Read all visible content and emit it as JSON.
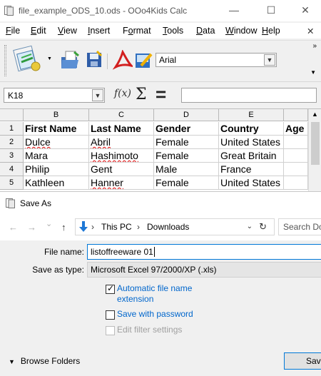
{
  "calc": {
    "window_title": "file_example_ODS_10.ods - OOo4Kids Calc",
    "controls": {
      "minimize": "—",
      "maximize": "☐",
      "close": "✕"
    },
    "menu": [
      {
        "pre": "",
        "u": "F",
        "post": "ile"
      },
      {
        "pre": "",
        "u": "E",
        "post": "dit"
      },
      {
        "pre": "",
        "u": "V",
        "post": "iew"
      },
      {
        "pre": "",
        "u": "I",
        "post": "nsert"
      },
      {
        "pre": "F",
        "u": "o",
        "post": "rmat"
      },
      {
        "pre": "",
        "u": "T",
        "post": "ools"
      },
      {
        "pre": "",
        "u": "D",
        "post": "ata"
      },
      {
        "pre": "",
        "u": "W",
        "post": "indow"
      },
      {
        "pre": "",
        "u": "H",
        "post": "elp"
      }
    ],
    "menu_close": "✕",
    "toolbar": {
      "icons": [
        "new-document-icon",
        "open-folder-icon",
        "save-icon",
        "export-pdf-icon",
        "edit-file-icon"
      ],
      "font_name": "Arial",
      "overflow": "»"
    },
    "formula_bar": {
      "cell_ref": "K18",
      "fx_label": "f(x)",
      "sum_label": "Σ",
      "equals_label": "=",
      "formula": ""
    },
    "sheet": {
      "columns": [
        "B",
        "C",
        "D",
        "E",
        ""
      ],
      "rows": [
        {
          "num": "1",
          "cells": [
            "First Name",
            "Last Name",
            "Gender",
            "Country",
            "Age"
          ]
        },
        {
          "num": "2",
          "cells": [
            "Dulce",
            "Abril",
            "Female",
            "United States",
            ""
          ]
        },
        {
          "num": "3",
          "cells": [
            "Mara",
            "Hashimoto",
            "Female",
            "Great Britain",
            ""
          ]
        },
        {
          "num": "4",
          "cells": [
            "Philip",
            "Gent",
            "Male",
            "France",
            ""
          ]
        },
        {
          "num": "5",
          "cells": [
            "Kathleen",
            "Hanner",
            "Female",
            "United States",
            ""
          ]
        }
      ]
    }
  },
  "dialog": {
    "title": "Save As",
    "nav": {
      "back": "←",
      "forward": "→",
      "recent": "⌄",
      "up": "↑"
    },
    "breadcrumb": [
      "This PC",
      "Downloads"
    ],
    "breadcrumb_sep": "›",
    "search_placeholder": "Search Do",
    "file_name_label": "File name:",
    "file_name_value": "listoffreeware 01",
    "save_type_label": "Save as type:",
    "save_type_value": "Microsoft Excel 97/2000/XP (.xls)",
    "options": {
      "auto_ext_label": "Automatic file name extension",
      "auto_ext_checked": true,
      "password_label": "Save with password",
      "password_checked": false,
      "filter_label": "Edit filter settings",
      "filter_checked": false
    },
    "browse_label": "Browse Folders",
    "save_label": "Save"
  }
}
